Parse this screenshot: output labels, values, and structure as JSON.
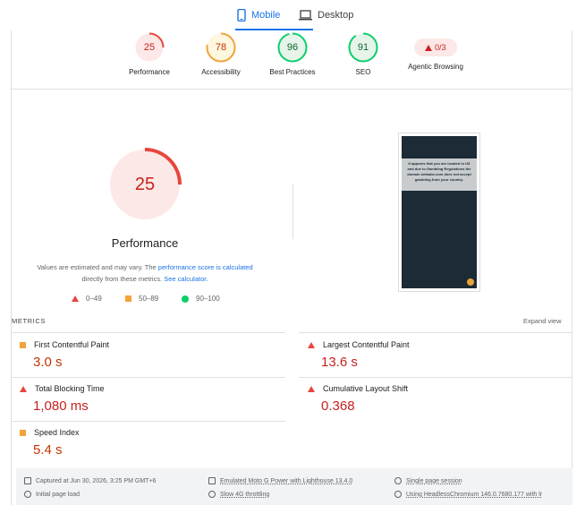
{
  "tabs": [
    {
      "label": "Mobile",
      "icon": "phone-icon",
      "active": true
    },
    {
      "label": "Desktop",
      "icon": "laptop-icon",
      "active": false
    }
  ],
  "gauges": [
    {
      "name": "performance",
      "score": "25",
      "label": "Performance",
      "color": "#e8453c",
      "fill": 0.25
    },
    {
      "name": "accessibility",
      "score": "78",
      "label": "Accessibility",
      "color": "#f2a33a",
      "fill": 0.78
    },
    {
      "name": "best-practices",
      "score": "96",
      "label": "Best Practices",
      "color": "#0cce6b",
      "fill": 0.96
    },
    {
      "name": "seo",
      "score": "91",
      "label": "SEO",
      "color": "#0cce6b",
      "fill": 0.91
    }
  ],
  "agentic": {
    "value": "0/3",
    "label": "Agentic Browsing"
  },
  "main_score": {
    "value": "25",
    "label": "Performance",
    "color": "#e8453c",
    "fill": 0.25
  },
  "disclaimer": {
    "text1": "Values are estimated and may vary. The ",
    "link1": "performance score is calculated",
    "text2": "directly from these metrics. ",
    "link2": "See calculator."
  },
  "legend": [
    {
      "range": "0–49",
      "icon": "triangle-icon"
    },
    {
      "range": "50–89",
      "icon": "square-icon"
    },
    {
      "range": "90–100",
      "icon": "circle-icon"
    }
  ],
  "screenshot": {
    "message": "It appears that you are located in US and due to Gambling Regulations the domain betbabe.com does not accept gambling from your country."
  },
  "metrics_header": {
    "title": "METRICS",
    "expand": "Expand view"
  },
  "metrics": [
    {
      "name": "First Contentful Paint",
      "value": "3.0 s",
      "status": "average",
      "color": "#c33300"
    },
    {
      "name": "Largest Contentful Paint",
      "value": "13.6 s",
      "status": "fail",
      "color": "#c5221f"
    },
    {
      "name": "Total Blocking Time",
      "value": "1,080 ms",
      "status": "fail",
      "color": "#c5221f"
    },
    {
      "name": "Cumulative Layout Shift",
      "value": "0.368",
      "status": "fail",
      "color": "#c5221f"
    },
    {
      "name": "Speed Index",
      "value": "5.4 s",
      "status": "average",
      "color": "#c33300"
    }
  ],
  "footer": {
    "captured": "Captured at Jun 30, 2026, 3:25 PM GMT+6",
    "initial": "Initial page load",
    "device": "Emulated Moto G Power with Lighthouse 13.4.0",
    "throttling": "Slow 4G throttling",
    "session": "Single page session",
    "browser": "Using HeadlessChromium 146.0.7680.177 with lr"
  }
}
